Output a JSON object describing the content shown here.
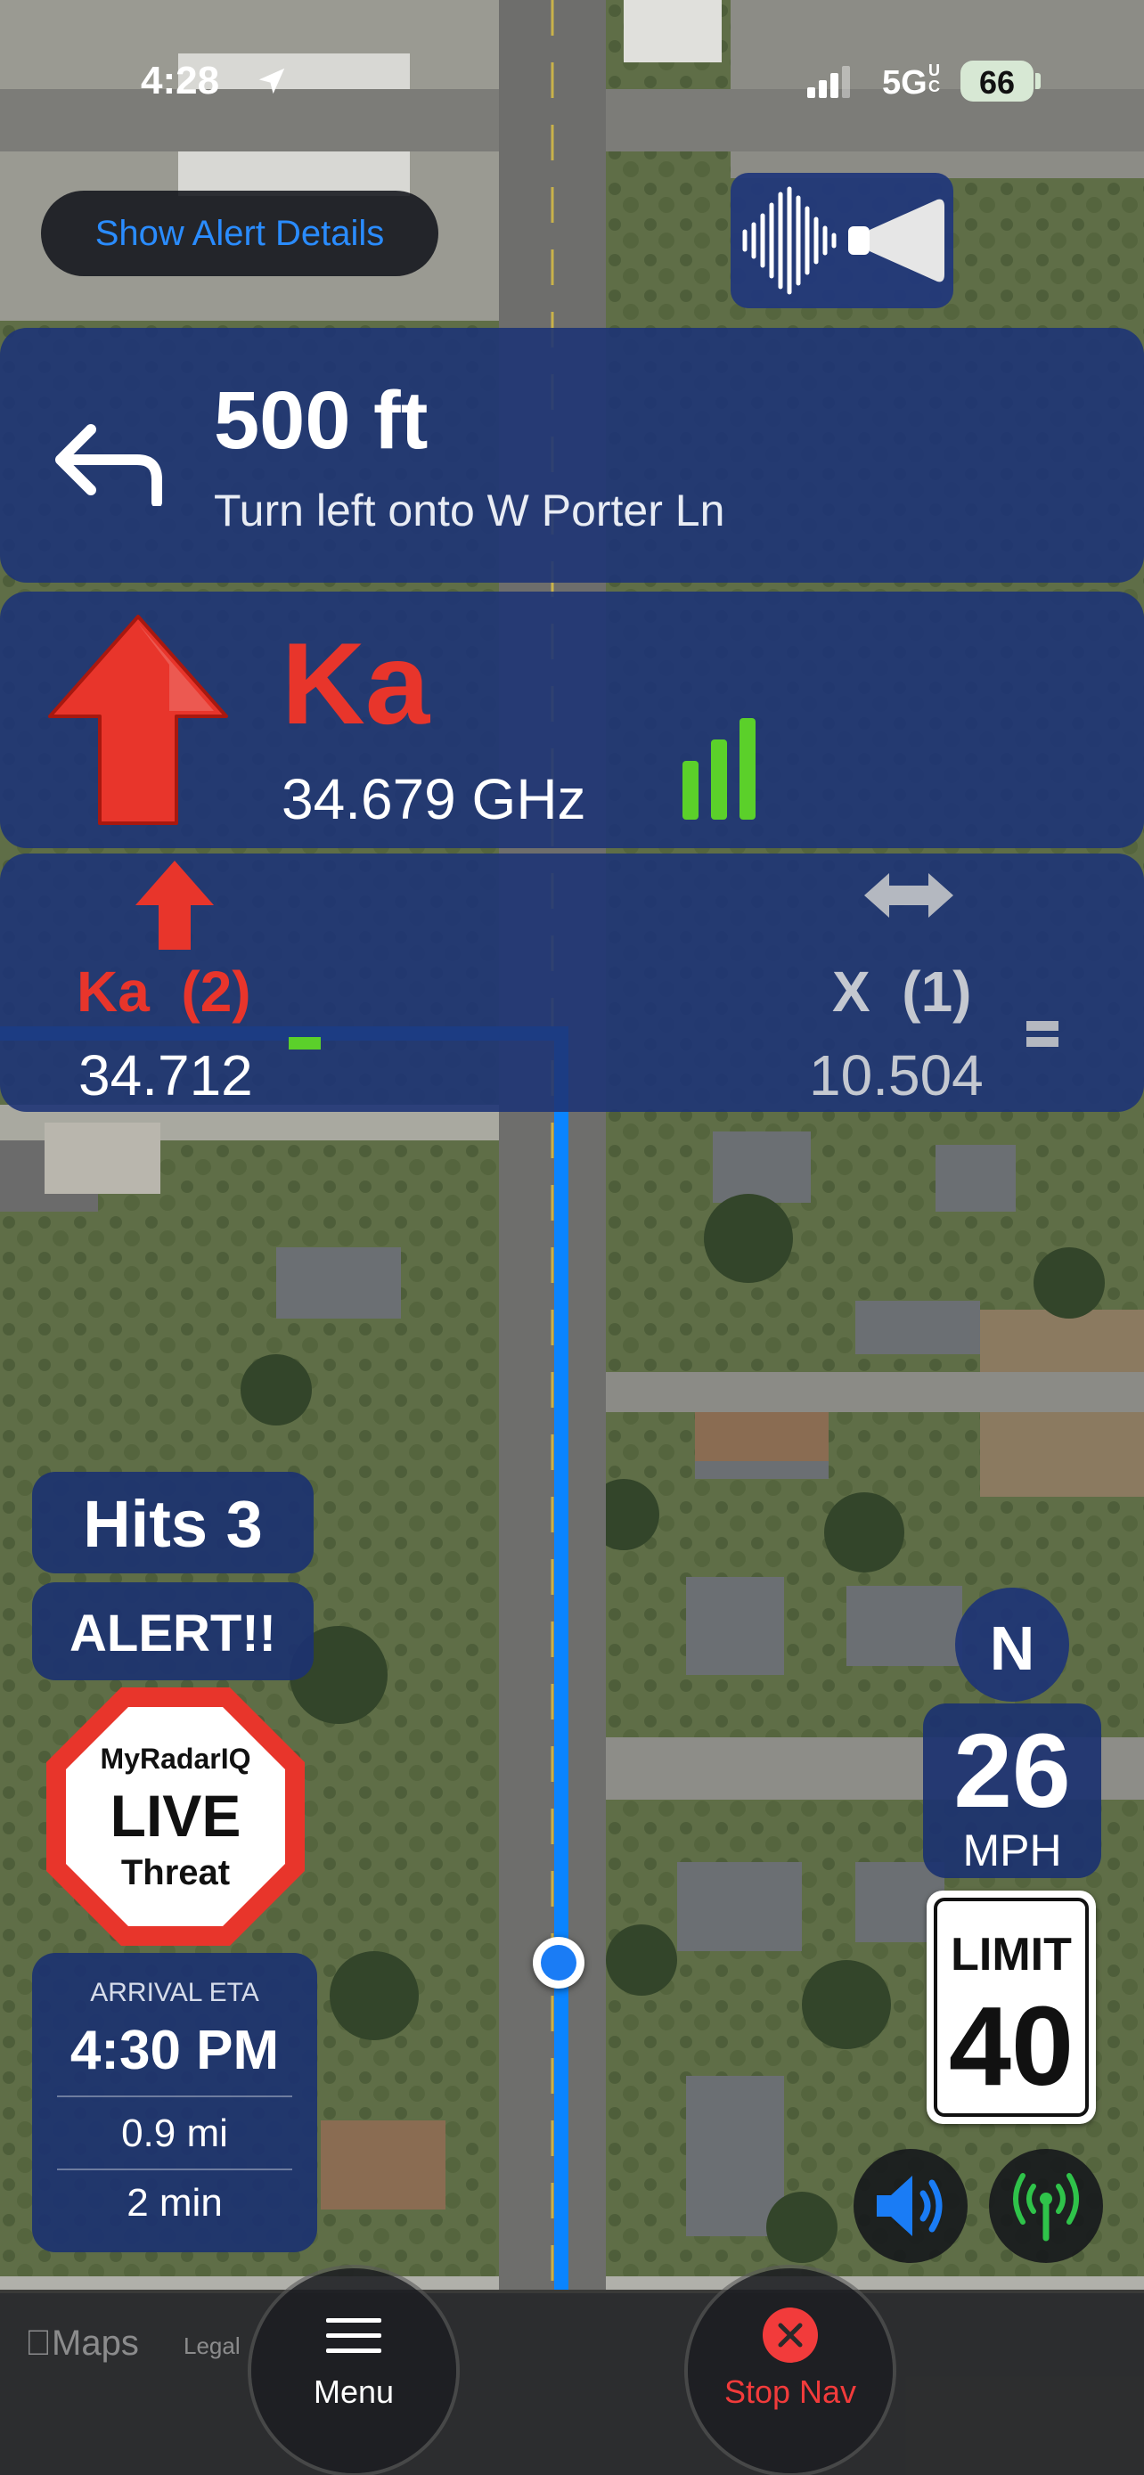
{
  "status_bar": {
    "time": "4:28",
    "network": "5G",
    "network_sup": "UC",
    "battery": "66"
  },
  "alert_details_label": "Show Alert Details",
  "direction": {
    "distance": "500 ft",
    "instruction": "Turn left onto W Porter Ln"
  },
  "main_alert": {
    "band": "Ka",
    "frequency": "34.679 GHz",
    "signal_bars": 3
  },
  "secondary_alerts": [
    {
      "band": "Ka",
      "count": "(2)",
      "frequency": "34.712"
    },
    {
      "band": "X",
      "count": "(1)",
      "frequency": "10.504"
    }
  ],
  "hits": "Hits 3",
  "alert_label": "ALERT!!",
  "badge": {
    "line1": "MyRadarIQ",
    "line2": "LIVE",
    "line3": "Threat"
  },
  "eta": {
    "label": "ARRIVAL ETA",
    "time": "4:30 PM",
    "distance": "0.9 mi",
    "duration": "2 min"
  },
  "compass": "N",
  "speed": {
    "value": "26",
    "unit": "MPH"
  },
  "limit": {
    "label": "LIMIT",
    "value": "40"
  },
  "maps_label": "Maps",
  "legal_label": "Legal",
  "bottom": {
    "menu_label": "Menu",
    "stop_label": "Stop Nav"
  },
  "colors": {
    "panel": "#1e3476",
    "alert_red": "#e8352b",
    "route_blue": "#0a84ff",
    "signal_green": "#5bd02a"
  }
}
